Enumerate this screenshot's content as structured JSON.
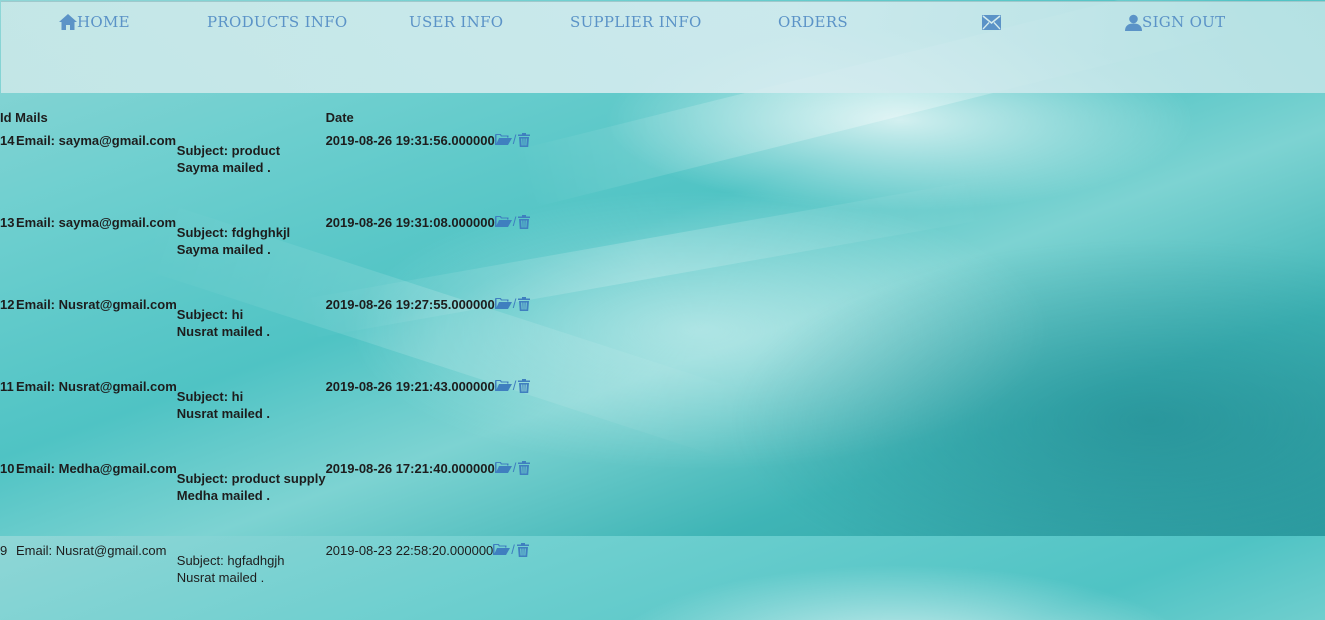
{
  "nav": {
    "home": "HOME",
    "products": "PRODUCTS INFO",
    "users": "USER INFO",
    "suppliers": "SUPPLIER INFO",
    "orders": "ORDERS",
    "signout": "SIGN OUT"
  },
  "table": {
    "headers": {
      "id_mails": "Id Mails",
      "date": "Date"
    },
    "separator": "/",
    "rows": [
      {
        "id": "14",
        "email": "Email: sayma@gmail.com",
        "subject": "Subject: product",
        "mailed": "Sayma mailed .",
        "date": "2019-08-26 19:31:56.000000"
      },
      {
        "id": "13",
        "email": "Email: sayma@gmail.com",
        "subject": "Subject: fdghghkjl",
        "mailed": "Sayma mailed .",
        "date": "2019-08-26 19:31:08.000000"
      },
      {
        "id": "12",
        "email": "Email: Nusrat@gmail.com",
        "subject": "Subject: hi",
        "mailed": "Nusrat mailed .",
        "date": "2019-08-26 19:27:55.000000"
      },
      {
        "id": "11",
        "email": "Email: Nusrat@gmail.com",
        "subject": "Subject: hi",
        "mailed": "Nusrat mailed .",
        "date": "2019-08-26 19:21:43.000000"
      },
      {
        "id": "10",
        "email": "Email: Medha@gmail.com",
        "subject": "Subject: product supply",
        "mailed": "Medha mailed .",
        "date": "2019-08-26 17:21:40.000000"
      },
      {
        "id": "9",
        "email": "Email: Nusrat@gmail.com",
        "subject": "Subject: hgfadhgjh",
        "mailed": "Nusrat mailed .",
        "date": "2019-08-23 22:58:20.000000"
      }
    ]
  }
}
